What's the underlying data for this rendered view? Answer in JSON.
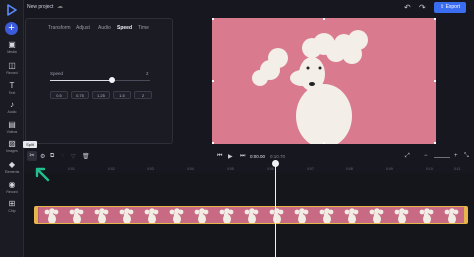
{
  "app": {
    "project_title": "New project",
    "export_label": "Export"
  },
  "sidebar": {
    "items": [
      {
        "label": "Media",
        "icon": "media-icon"
      },
      {
        "label": "Record",
        "icon": "record-icon"
      },
      {
        "label": "Text",
        "icon": "text-icon"
      },
      {
        "label": "Audio",
        "icon": "audio-icon"
      },
      {
        "label": "Videos",
        "icon": "videos-icon"
      },
      {
        "label": "Images",
        "icon": "images-icon"
      },
      {
        "label": "Elements",
        "icon": "elements-icon"
      },
      {
        "label": "Record",
        "icon": "record-circle-icon"
      },
      {
        "label": "Chip",
        "icon": "chip-icon"
      }
    ]
  },
  "properties": {
    "tabs": [
      "Transform",
      "Adjust",
      "Audio",
      "Speed",
      "Time"
    ],
    "active_tab": "Speed",
    "speed_label": "Speed",
    "speed_value": "2",
    "speed_fraction": 0.62,
    "presets": [
      "0.5",
      "0.75",
      "1.25",
      "1.5",
      "2"
    ]
  },
  "toolbar": {
    "tooltip": "Split",
    "current_time": "0:00.00",
    "duration": "0:10.70"
  },
  "ruler": {
    "ticks": [
      "0:01",
      "0:02",
      "0:03",
      "0:04",
      "0:05",
      "0:06",
      "0:07",
      "0:08",
      "0:09",
      "0:10",
      "0:11"
    ]
  },
  "colors": {
    "accent": "#3b6df0",
    "preview_bg": "#d97a8e",
    "clip_border": "#e7b64a",
    "annotation_arrow": "#1fbf8f"
  }
}
